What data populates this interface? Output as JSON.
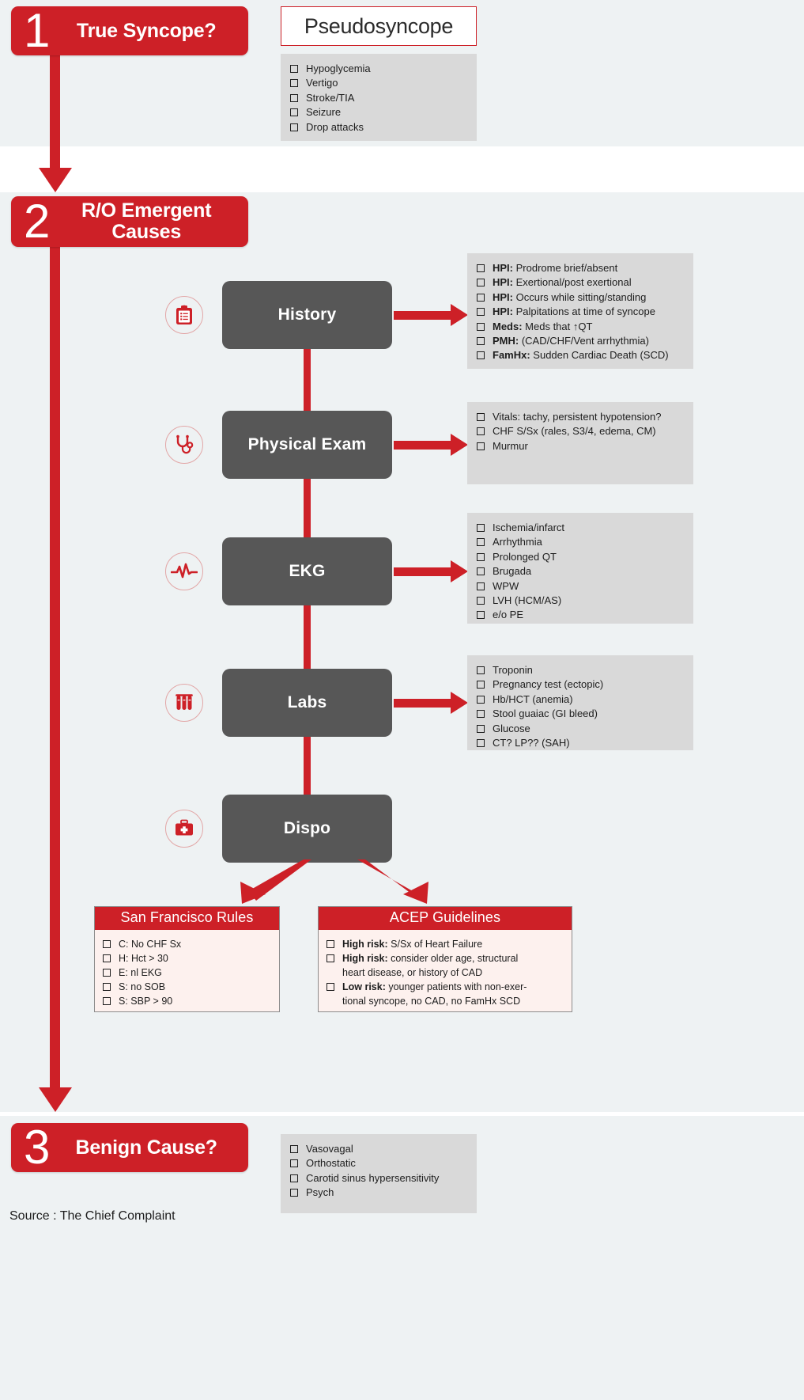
{
  "colors": {
    "brand_red": "#cd2027",
    "panel_bg": "#eef2f3",
    "box_dark": "#575757",
    "checklist_bg": "#d9d9d9",
    "rulebox_bg": "#fdf1ee"
  },
  "steps": [
    {
      "number": "1",
      "title": "True Syncope?"
    },
    {
      "number": "2",
      "title": "R/O Emergent Causes"
    },
    {
      "number": "3",
      "title": "Benign Cause?"
    }
  ],
  "step1": {
    "callout_title": "Pseudosyncope",
    "items": [
      "Hypoglycemia",
      "Vertigo",
      "Stroke/TIA",
      "Seizure",
      "Drop attacks"
    ]
  },
  "step2": {
    "nodes": [
      {
        "label": "History",
        "icon": "clipboard-icon"
      },
      {
        "label": "Physical Exam",
        "icon": "stethoscope-icon"
      },
      {
        "label": "EKG",
        "icon": "heartbeat-icon"
      },
      {
        "label": "Labs",
        "icon": "test-tubes-icon"
      },
      {
        "label": "Dispo",
        "icon": "medical-kit-icon"
      }
    ],
    "history_items": [
      {
        "bold": "HPI:",
        "text": " Prodrome brief/absent"
      },
      {
        "bold": "HPI:",
        "text": " Exertional/post exertional"
      },
      {
        "bold": "HPI:",
        "text": " Occurs while sitting/standing"
      },
      {
        "bold": "HPI:",
        "text": " Palpitations at time of syncope"
      },
      {
        "bold": "Meds:",
        "text": " Meds that ↑QT"
      },
      {
        "bold": "PMH:",
        "text": " (CAD/CHF/Vent arrhythmia)"
      },
      {
        "bold": "FamHx:",
        "text": " Sudden Cardiac Death (SCD)"
      }
    ],
    "pe_items": [
      {
        "bold": "",
        "text": "Vitals: tachy, persistent hypotension?"
      },
      {
        "bold": "",
        "text": "CHF S/Sx (rales, S3/4, edema, CM)"
      },
      {
        "bold": "",
        "text": "Murmur"
      }
    ],
    "ekg_items": [
      {
        "bold": "",
        "text": "Ischemia/infarct"
      },
      {
        "bold": "",
        "text": "Arrhythmia"
      },
      {
        "bold": "",
        "text": "Prolonged QT"
      },
      {
        "bold": "",
        "text": "Brugada"
      },
      {
        "bold": "",
        "text": "WPW"
      },
      {
        "bold": "",
        "text": "LVH (HCM/AS)"
      },
      {
        "bold": "",
        "text": "e/o PE"
      }
    ],
    "labs_items": [
      {
        "bold": "",
        "text": "Troponin"
      },
      {
        "bold": "",
        "text": "Pregnancy test (ectopic)"
      },
      {
        "bold": "",
        "text": "Hb/HCT (anemia)"
      },
      {
        "bold": "",
        "text": "Stool guaiac (GI bleed)"
      },
      {
        "bold": "",
        "text": "Glucose"
      },
      {
        "bold": "",
        "text": "CT?  LP?? (SAH)"
      }
    ],
    "sf_rules": {
      "title": "San Francisco Rules",
      "items": [
        {
          "bold": "",
          "text": "C: No CHF Sx"
        },
        {
          "bold": "",
          "text": "H: Hct > 30"
        },
        {
          "bold": "",
          "text": "E: nl EKG"
        },
        {
          "bold": "",
          "text": "S: no SOB"
        },
        {
          "bold": "",
          "text": "S: SBP > 90"
        }
      ]
    },
    "acep": {
      "title": "ACEP Guidelines",
      "items": [
        {
          "bold": "High risk:",
          "text": " S/Sx of Heart Failure",
          "cont": ""
        },
        {
          "bold": "High risk:",
          "text": " consider older age, structural",
          "cont": "heart disease, or history of CAD"
        },
        {
          "bold": "Low risk:",
          "text": " younger patients with non-exer-",
          "cont": "tional syncope, no CAD, no FamHx SCD"
        }
      ]
    }
  },
  "step3": {
    "items": [
      "Vasovagal",
      "Orthostatic",
      "Carotid sinus hypersensitivity",
      "Psych"
    ]
  },
  "footer": {
    "source": "Source : The Chief Complaint"
  }
}
